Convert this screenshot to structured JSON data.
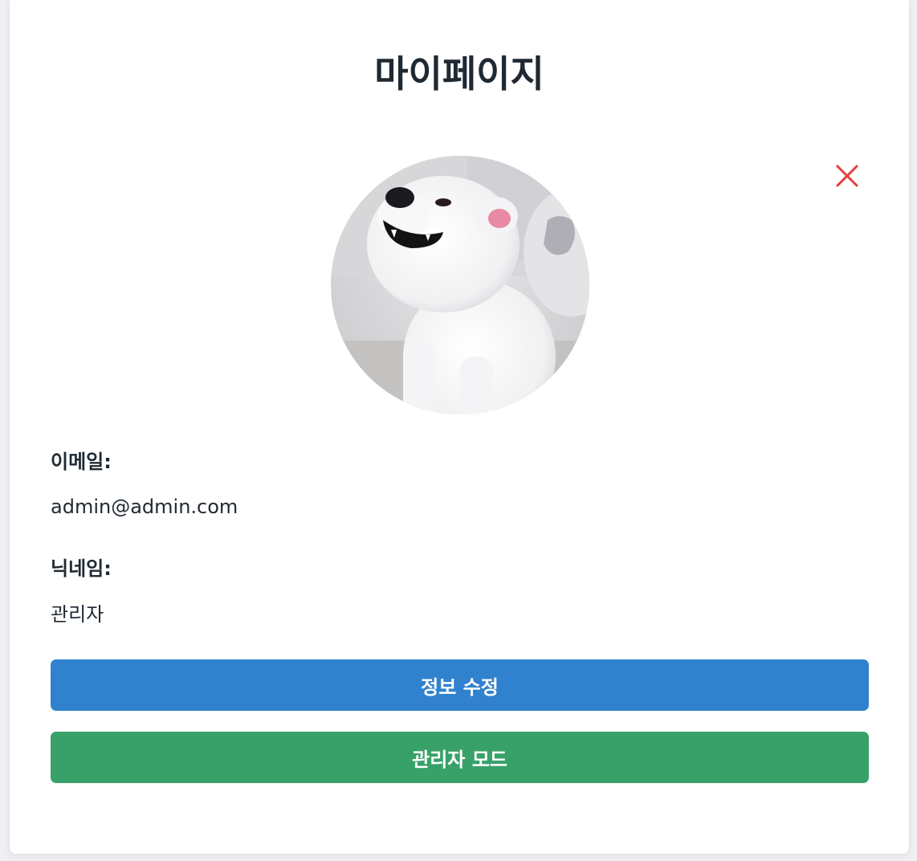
{
  "page": {
    "title": "마이페이지"
  },
  "profile": {
    "avatar_alt": "profile-photo-white-dog",
    "email_label": "이메일:",
    "email_value": "admin@admin.com",
    "nickname_label": "닉네임:",
    "nickname_value": "관리자"
  },
  "actions": {
    "edit_label": "정보 수정",
    "admin_label": "관리자 모드",
    "close_icon": "close-icon"
  },
  "colors": {
    "edit_button": "#3182ce",
    "admin_button": "#38a169",
    "close_icon": "#e53e3e",
    "text": "#1f2933"
  }
}
